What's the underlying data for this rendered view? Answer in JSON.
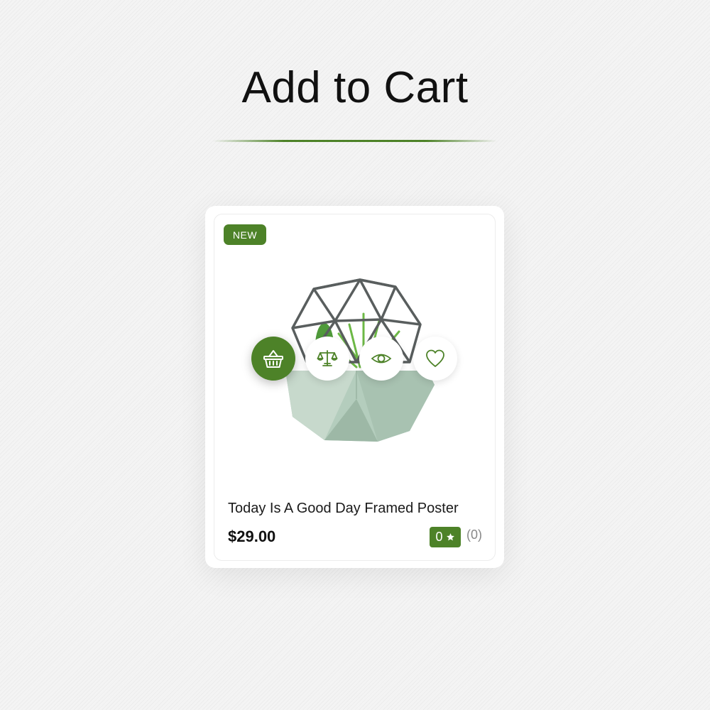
{
  "page": {
    "heading": "Add to Cart"
  },
  "product": {
    "badge": "NEW",
    "title": "Today Is A Good Day Framed Poster",
    "price": "$29.00",
    "rating": "0",
    "review_count": "(0)",
    "accent_color": "#4d8228"
  },
  "actions": [
    {
      "name": "add-to-cart",
      "icon": "basket-icon",
      "active": true
    },
    {
      "name": "compare",
      "icon": "balance-scale-icon",
      "active": false
    },
    {
      "name": "quick-view",
      "icon": "eye-icon",
      "active": false
    },
    {
      "name": "wishlist",
      "icon": "heart-icon",
      "active": false
    }
  ]
}
